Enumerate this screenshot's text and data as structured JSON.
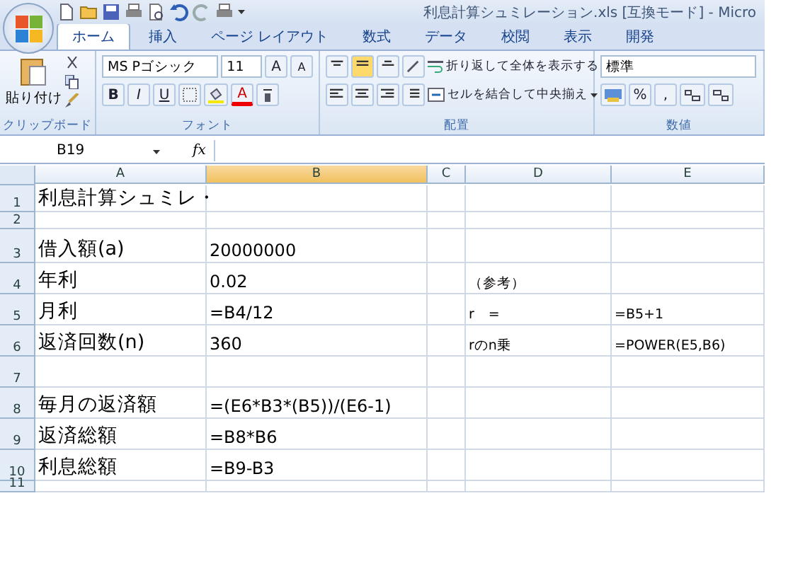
{
  "window": {
    "title": "利息計算シュミレーション.xls  [互換モード] - Micro"
  },
  "tabs": [
    {
      "label": "ホーム",
      "selected": true
    },
    {
      "label": "挿入",
      "selected": false
    },
    {
      "label": "ページ レイアウト",
      "selected": false
    },
    {
      "label": "数式",
      "selected": false
    },
    {
      "label": "データ",
      "selected": false
    },
    {
      "label": "校閲",
      "selected": false
    },
    {
      "label": "表示",
      "selected": false
    },
    {
      "label": "開発",
      "selected": false
    }
  ],
  "ribbon": {
    "clipboard": {
      "paste": "貼り付け",
      "group": "クリップボード"
    },
    "font": {
      "name": "MS Pゴシック",
      "size": "11",
      "grow": "A",
      "shrink": "A",
      "bold": "B",
      "italic": "I",
      "underline": "U",
      "font_color": "A",
      "group": "フォント"
    },
    "alignment": {
      "wrap": "折り返して全体を表示する",
      "merge": "セルを結合して中央揃え",
      "group": "配置"
    },
    "number": {
      "format": "標準",
      "percent": "%",
      "comma": ",",
      "group": "数値"
    }
  },
  "formula_bar": {
    "name_box": "B19",
    "fx": "fx"
  },
  "columns": [
    {
      "label": "A",
      "selected": false
    },
    {
      "label": "B",
      "selected": true
    },
    {
      "label": "C",
      "selected": false
    },
    {
      "label": "D",
      "selected": false
    },
    {
      "label": "E",
      "selected": false
    }
  ],
  "rows": [
    {
      "number": "1",
      "cells": [
        "利息計算シュミレ・",
        "",
        "",
        "",
        ""
      ]
    },
    {
      "number": "2",
      "cells": [
        "",
        "",
        "",
        "",
        ""
      ]
    },
    {
      "number": "3",
      "cells": [
        "借入額(a)",
        "20000000",
        "",
        "",
        ""
      ]
    },
    {
      "number": "4",
      "cells": [
        "年利",
        "0.02",
        "",
        "（参考）",
        ""
      ]
    },
    {
      "number": "5",
      "cells": [
        "月利",
        "=B4/12",
        "",
        "r　=",
        "=B5+1"
      ]
    },
    {
      "number": "6",
      "cells": [
        "返済回数(n)",
        "360",
        "",
        "rのn乗",
        "=POWER(E5,B6)"
      ]
    },
    {
      "number": "7",
      "cells": [
        "",
        "",
        "",
        "",
        ""
      ]
    },
    {
      "number": "8",
      "cells": [
        "毎月の返済額",
        "=(E6*B3*(B5))/(E6-1)",
        "",
        "",
        ""
      ]
    },
    {
      "number": "9",
      "cells": [
        "返済総額",
        "=B8*B6",
        "",
        "",
        ""
      ]
    },
    {
      "number": "10",
      "cells": [
        "利息総額",
        "=B9-B3",
        "",
        "",
        ""
      ]
    },
    {
      "number": "11",
      "cells": [
        "",
        "",
        "",
        "",
        ""
      ]
    }
  ]
}
